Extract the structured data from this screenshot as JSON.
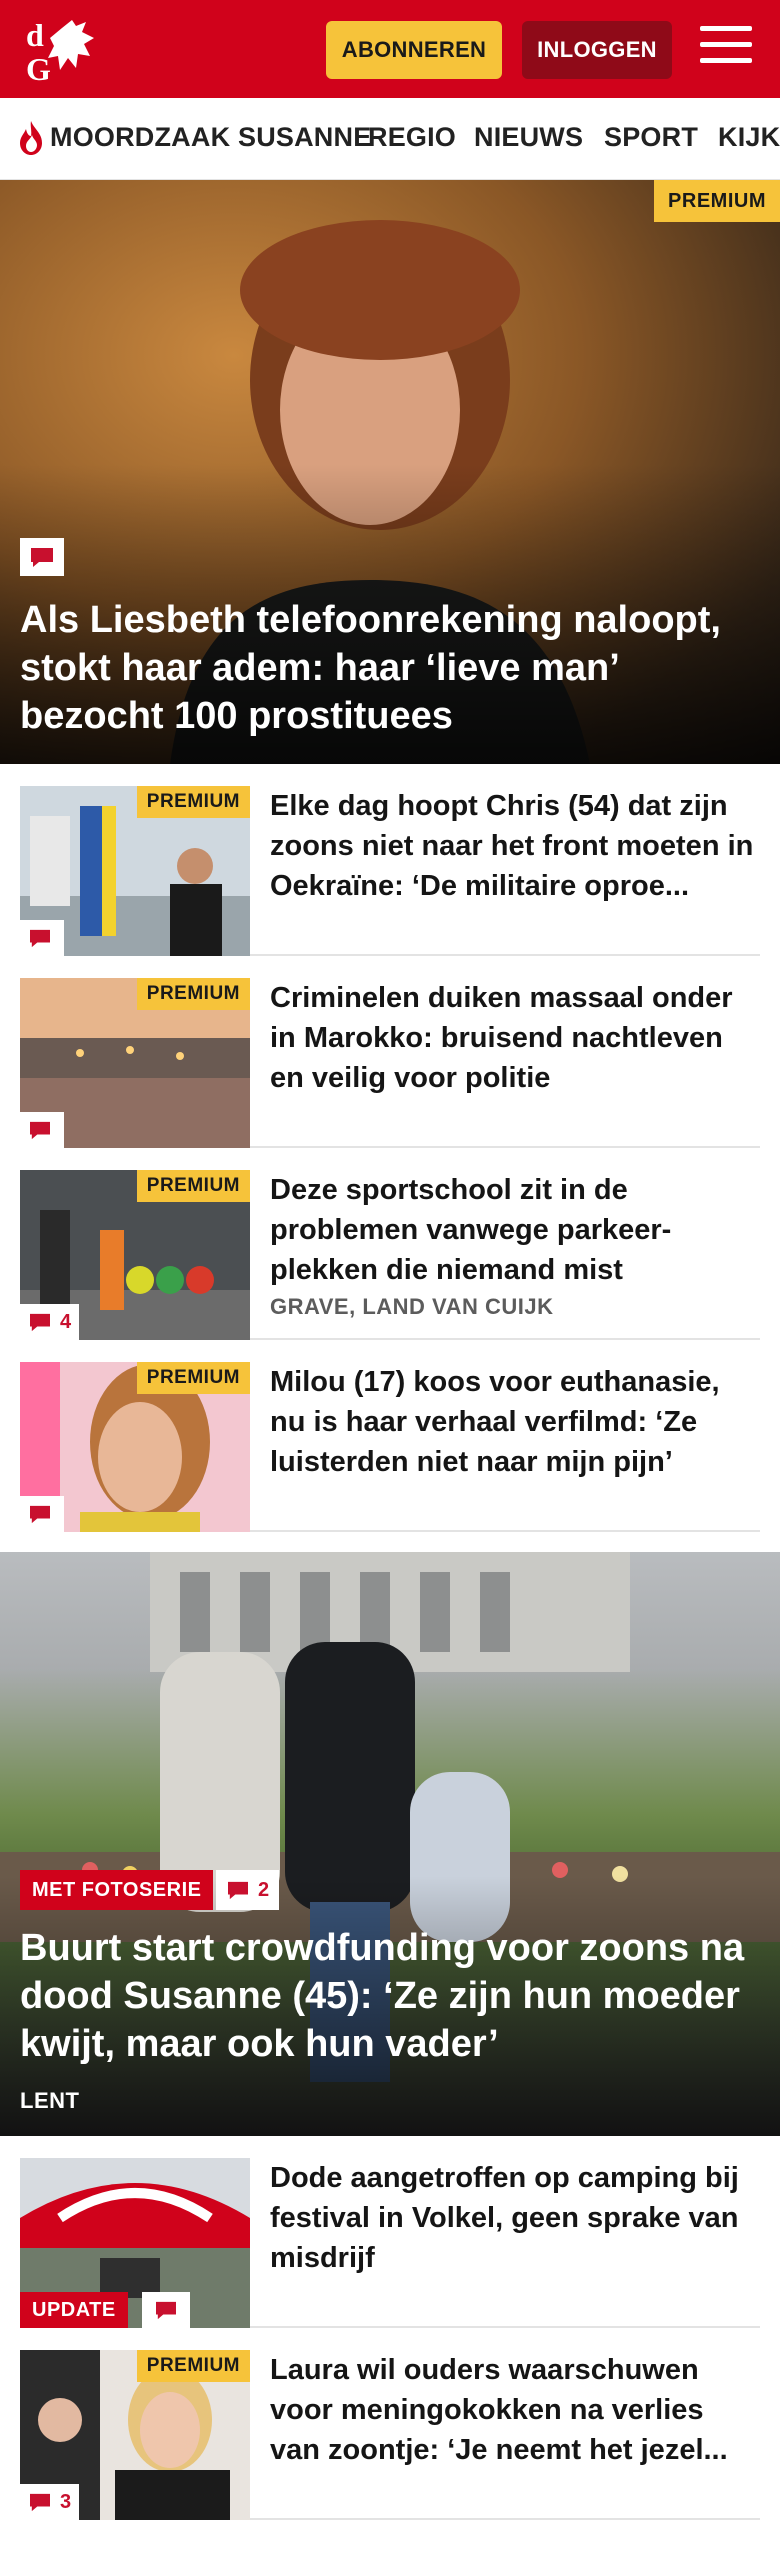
{
  "header": {
    "logo_text": "dG",
    "subscribe_label": "ABONNEREN",
    "login_label": "INLOGGEN",
    "menu_icon": "hamburger-icon",
    "brand_color": "#d0021b"
  },
  "nav": {
    "items": [
      {
        "label": "MOORDZAAK SUSANNE",
        "icon": "flame-icon"
      },
      {
        "label": "REGIO"
      },
      {
        "label": "NIEUWS"
      },
      {
        "label": "SPORT"
      },
      {
        "label": "KIJK"
      }
    ]
  },
  "hero": {
    "badge": "PREMIUM",
    "title": "Als Liesbeth telefoonrekening naloopt, stokt haar adem: haar ‘lieve man’ bezocht 100 prostituees",
    "comment_icon": "comment-icon"
  },
  "articles": [
    {
      "badge": "PREMIUM",
      "title": "Elke dag hoopt Chris (54) dat zijn zoons niet naar het front moeten in Oekraïne: ‘De militaire oproe...",
      "comments": ""
    },
    {
      "badge": "PREMIUM",
      "title": "Criminelen duiken massaal onder in Marokko: bruisend nachtleven en veilig voor politie",
      "comments": ""
    },
    {
      "badge": "PREMIUM",
      "title": "Deze sportschool zit in de problemen vanwege parkeer-plekken die niemand mist",
      "location": "GRAVE, LAND VAN CUIJK",
      "comments": "4"
    },
    {
      "badge": "PREMIUM",
      "title": "Milou (17) koos voor euthanasie, nu is haar verhaal verfilmd: ‘Ze luisterden niet naar mijn pijn’",
      "comments": ""
    }
  ],
  "hero2": {
    "tag": "MET FOTOSERIE",
    "comments": "2",
    "title": "Buurt start crowdfunding voor zoons na dood Susanne (45): ‘Ze zijn hun moeder kwijt, maar ook hun vader’",
    "location": "LENT"
  },
  "articles2": [
    {
      "tag": "UPDATE",
      "title": "Dode aangetroffen op camping bij festival in Volkel, geen sprake van misdrijf",
      "comments": ""
    },
    {
      "badge": "PREMIUM",
      "title": "Laura wil ouders waarschuwen voor meningokokken na verlies van zoontje: ‘Je neemt het jezel...",
      "comments": "3"
    }
  ]
}
